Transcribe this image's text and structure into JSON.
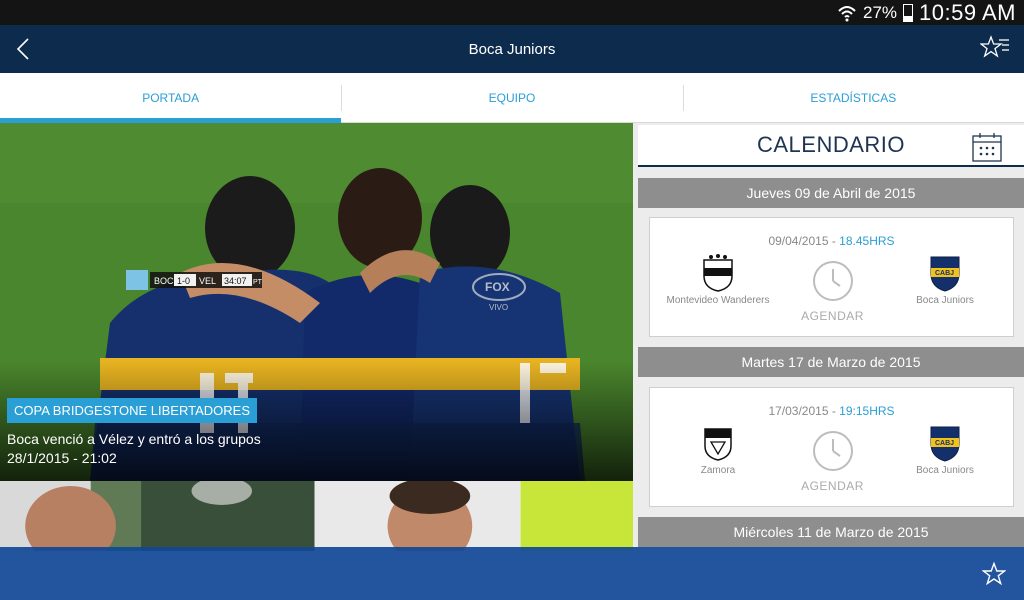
{
  "status": {
    "battery": "27%",
    "time": "10:59 AM"
  },
  "appbar": {
    "title": "Boca Juniors"
  },
  "tabs": [
    {
      "label": "PORTADA"
    },
    {
      "label": "EQUIPO"
    },
    {
      "label": "ESTADÍSTICAS"
    }
  ],
  "hero": {
    "category": "COPA BRIDGESTONE LIBERTADORES",
    "headline": "Boca venció a Vélez y entró a los grupos",
    "date": "28/1/2015 - 21:02",
    "scorebug": {
      "home": "BOC",
      "score": "1-0",
      "away": "VEL",
      "clock": "34:07",
      "period": "PT"
    },
    "broadcaster": "FOX SPORTS",
    "live": "VIVO"
  },
  "calendar": {
    "title": "CALENDARIO",
    "groups": [
      {
        "date_label": "Jueves 09 de Abril de 2015",
        "match": {
          "date": "09/04/2015",
          "time": "18.45HRS",
          "home": "Montevideo Wanderers",
          "away": "Boca Juniors",
          "action": "AGENDAR"
        }
      },
      {
        "date_label": "Martes 17 de Marzo de 2015",
        "match": {
          "date": "17/03/2015",
          "time": "19:15HRS",
          "home": "Zamora",
          "away": "Boca Juniors",
          "action": "AGENDAR"
        }
      },
      {
        "date_label": "Miércoles 11 de Marzo de 2015"
      }
    ]
  },
  "colors": {
    "navy": "#0c2b4d",
    "accent": "#2a9fd6",
    "boca_yellow": "#f2c21b",
    "boca_blue": "#14306a"
  }
}
